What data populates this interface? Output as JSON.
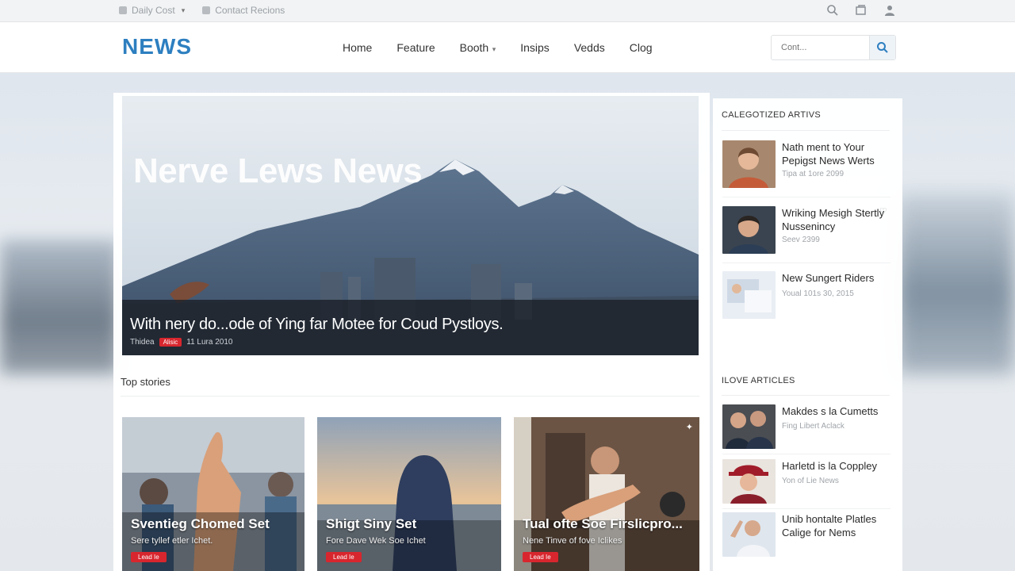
{
  "utility": {
    "left_items": [
      "Daily Cost",
      "Contact Recions"
    ]
  },
  "header": {
    "logo": "NEWS",
    "nav": [
      {
        "label": "Home",
        "has_dropdown": false
      },
      {
        "label": "Feature",
        "has_dropdown": false
      },
      {
        "label": "Booth",
        "has_dropdown": true
      },
      {
        "label": "Insips",
        "has_dropdown": false
      },
      {
        "label": "Vedds",
        "has_dropdown": false
      },
      {
        "label": "Clog",
        "has_dropdown": false
      }
    ],
    "search_placeholder": "Cont...",
    "accent": "#2d7fc0"
  },
  "hero": {
    "overlay_title": "Nerve Lews News",
    "headline": "With nery do...ode of Ying far Motee for Coud Pystloys.",
    "meta_source": "Thidea",
    "meta_tag": "Alisic",
    "meta_date": "11 Lura 2010"
  },
  "top_stories": {
    "title": "Top stories",
    "items": [
      {
        "title": "Sventieg Chomed Set",
        "subtitle": "Sere tyllef etler Ichet.",
        "tag": "Lead Ie"
      },
      {
        "title": "Shigt Siny Set",
        "subtitle": "Fore Dave Wek Soe Ichet",
        "tag": "Lead Ie"
      },
      {
        "title": "Tual ofte Soe Firslicpro...",
        "subtitle": "Nene Tinve of fove Iclikes",
        "tag": "Lead Ie"
      }
    ]
  },
  "sidebar": {
    "categorized": {
      "heading": "CALEGOTIZED ARTIVS",
      "items": [
        {
          "title": "Nath ment to Your Pepigst News Werts",
          "meta": "Tipa at 1ore 2099"
        },
        {
          "title": "Wriking Mesigh Stertly Nussenincy",
          "meta": "Seev 2399"
        },
        {
          "title": "New Sungert Riders",
          "meta": "Youal 101s 30, 2015"
        }
      ]
    },
    "love": {
      "heading": "ILOVE ARTICLES",
      "items": [
        {
          "title": "Makdes s la Cumetts",
          "meta": "Fing Libert Aclack"
        },
        {
          "title": "Harletd is la Coppley",
          "meta": "Yon of Lie News"
        },
        {
          "title": "Unib hontalte Platles Calige for Nems",
          "meta": ""
        }
      ]
    }
  },
  "colors": {
    "tag_red": "#d8262e",
    "caption_bg": "#1c2129"
  }
}
